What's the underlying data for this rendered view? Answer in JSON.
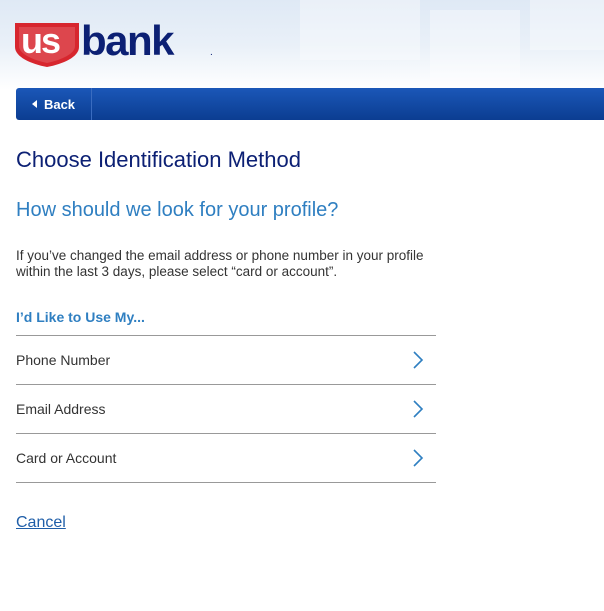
{
  "brand": {
    "logo_text": "usbank",
    "shield_color": "#d7262e",
    "text_color": "#0c2074"
  },
  "nav": {
    "back_label": "Back",
    "back_icon": "caret-left-icon",
    "bar_color": "#0b3d91"
  },
  "main": {
    "title": "Choose Identification Method",
    "subtitle": "How should we look for your profile?",
    "info": "If you’ve changed the email address or phone number in your profile within the last 3 days, please select “card or account”.",
    "choice_label": "I’d Like to Use My...",
    "options": [
      {
        "label": "Phone Number",
        "icon": "chevron-right-icon"
      },
      {
        "label": "Email Address",
        "icon": "chevron-right-icon"
      },
      {
        "label": "Card or Account",
        "icon": "chevron-right-icon"
      }
    ],
    "cancel_label": "Cancel"
  }
}
